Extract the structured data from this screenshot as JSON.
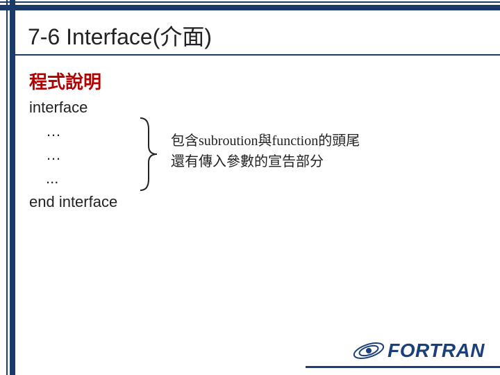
{
  "title": "7-6 Interface(介面)",
  "section_heading": "程式說明",
  "code": {
    "l0": "interface",
    "l1": "…",
    "l2": "…",
    "l3": "...",
    "l4": "end interface"
  },
  "annotation": {
    "line1": "包含subroution與function的頭尾",
    "line2": "還有傳入參數的宣告部分"
  },
  "logo_text": "FORTRAN"
}
